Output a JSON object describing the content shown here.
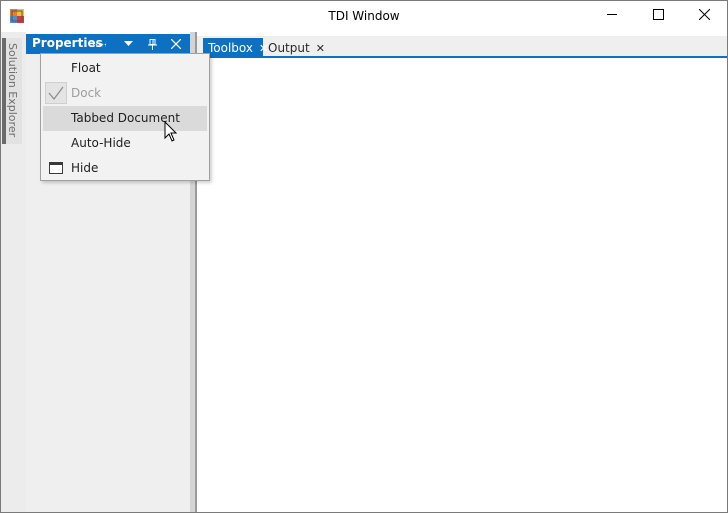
{
  "window": {
    "title": "TDI Window"
  },
  "autohide": {
    "label": "Solution Explorer"
  },
  "pane": {
    "title": "Properties"
  },
  "tabs": [
    {
      "label": "Toolbox",
      "active": true
    },
    {
      "label": "Output",
      "active": false
    }
  ],
  "menu": {
    "items": [
      {
        "label": "Float",
        "state": "normal"
      },
      {
        "label": "Dock",
        "state": "disabled-checked"
      },
      {
        "label": "Tabbed Document",
        "state": "hover"
      },
      {
        "label": "Auto-Hide",
        "state": "normal"
      },
      {
        "label": "Hide",
        "state": "normal"
      }
    ]
  },
  "colors": {
    "accent": "#0e70c0",
    "pane_background": "#efefef",
    "menu_background": "#f2f2f2",
    "menu_hover": "#dadada",
    "disabled_text": "#9d9d9d"
  },
  "icons": {
    "app": "tdi-app-icon",
    "minimize": "minimize-icon",
    "maximize": "maximize-icon",
    "close": "close-icon",
    "dropdown": "chevron-down-icon",
    "pin": "pin-icon",
    "checkmark": "checkmark-icon",
    "hide": "window-icon"
  }
}
